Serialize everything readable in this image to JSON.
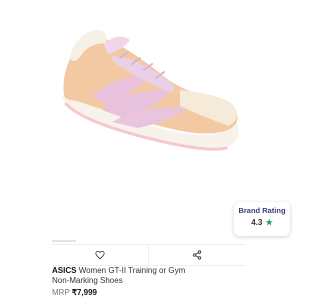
{
  "product": {
    "brand": "ASICS",
    "name_line1": "Women GT-II Training or Gym",
    "name_line2": "Non-Marking Shoes",
    "mrp_label": "MRP",
    "price": "₹7,999",
    "image_description_icon": "sneaker-image"
  },
  "rating": {
    "title": "Brand Rating",
    "value": "4.3",
    "star": "★",
    "star_color": "#1aa260"
  },
  "actions": {
    "wishlist_icon": "heart-icon",
    "share_icon": "share-icon"
  },
  "colors": {
    "shoe_peach": "#f3cfa9",
    "shoe_lavender": "#e9c4de",
    "text_navy": "#3a3f7a"
  }
}
